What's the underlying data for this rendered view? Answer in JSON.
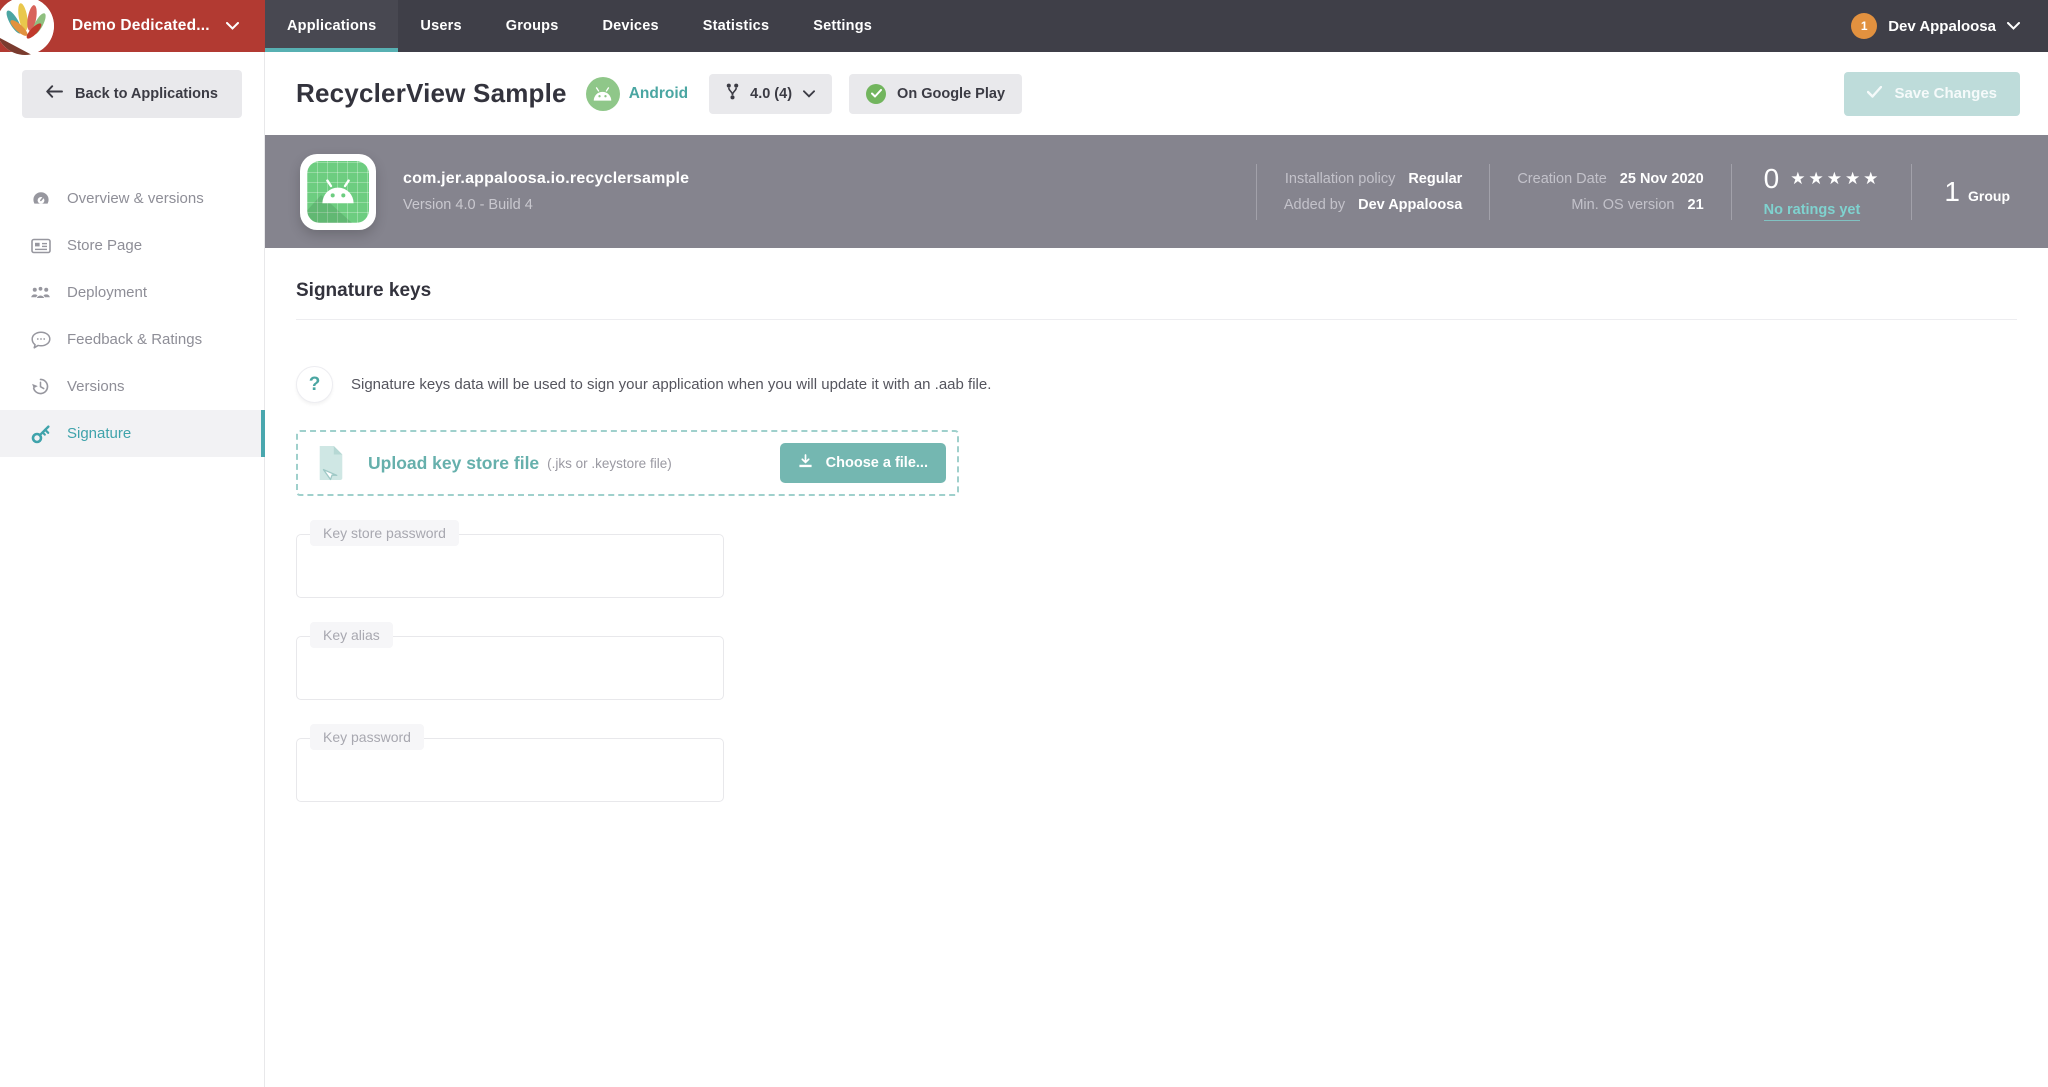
{
  "topbar": {
    "org_label": "Demo Dedicated...",
    "tabs": [
      {
        "label": "Applications",
        "active": true
      },
      {
        "label": "Users",
        "active": false
      },
      {
        "label": "Groups",
        "active": false
      },
      {
        "label": "Devices",
        "active": false
      },
      {
        "label": "Statistics",
        "active": false
      },
      {
        "label": "Settings",
        "active": false
      }
    ],
    "user": {
      "name": "Dev Appaloosa",
      "badge_count": "1"
    }
  },
  "header": {
    "back_label": "Back to Applications",
    "app_title": "RecyclerView Sample",
    "platform_label": "Android",
    "version_label": "4.0 (4)",
    "store_badge_label": "On Google Play",
    "save_label": "Save Changes"
  },
  "infobar": {
    "package_name": "com.jer.appaloosa.io.recyclersample",
    "version_line": "Version 4.0 - Build 4",
    "meta_left": [
      {
        "label": "Installation policy",
        "value": "Regular"
      },
      {
        "label": "Added by",
        "value": "Dev Appaloosa"
      }
    ],
    "meta_right": [
      {
        "label": "Creation Date",
        "value": "25 Nov 2020"
      },
      {
        "label": "Min. OS version",
        "value": "21"
      }
    ],
    "rating": {
      "score": "0",
      "stars": "★★★★★",
      "link_label": "No ratings yet"
    },
    "groups": {
      "count": "1",
      "label": "Group"
    }
  },
  "sidebar": {
    "items": [
      {
        "label": "Overview & versions",
        "icon": "gauge-icon",
        "active": false
      },
      {
        "label": "Store Page",
        "icon": "store-card-icon",
        "active": false
      },
      {
        "label": "Deployment",
        "icon": "users-group-icon",
        "active": false
      },
      {
        "label": "Feedback & Ratings",
        "icon": "speech-bubble-icon",
        "active": false
      },
      {
        "label": "Versions",
        "icon": "history-icon",
        "active": false
      },
      {
        "label": "Signature",
        "icon": "key-icon",
        "active": true
      }
    ]
  },
  "content": {
    "section_title": "Signature keys",
    "help_icon": "?",
    "help_text": "Signature keys data will be used to sign your application when you will update it with an .aab file.",
    "upload": {
      "title": "Upload key store file",
      "hint": "(.jks or .keystore file)",
      "button_label": "Choose a file..."
    },
    "fields": [
      {
        "label": "Key store password",
        "value": ""
      },
      {
        "label": "Key alias",
        "value": ""
      },
      {
        "label": "Key password",
        "value": ""
      }
    ]
  },
  "colors": {
    "brand_red": "#b23a32",
    "topbar_charcoal": "#3f3f48",
    "accent_teal": "#4aa6a2",
    "tab_underline_teal": "#57b0b2",
    "infobar_gray": "#85848e",
    "app_icon_green": "#6dcd80",
    "platform_badge_green": "#8fc789",
    "play_check_green": "#72b55e",
    "save_disabled_teal": "#bedcda",
    "avatar_orange": "#e2913f"
  }
}
